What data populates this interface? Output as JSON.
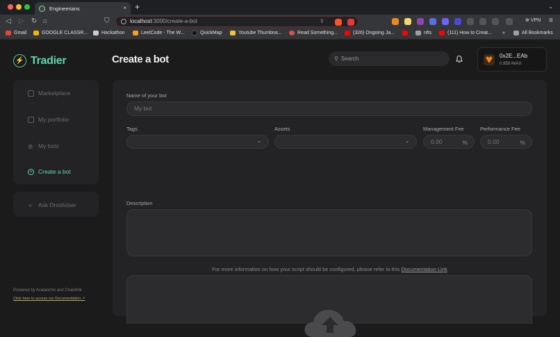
{
  "browser": {
    "tab_title": "Engineerians",
    "tab_close": "×",
    "new_tab": "+",
    "url_host": "localhost",
    "url_path": ":3000/create-a-bot",
    "vpn_label": "VPN",
    "bookmarks": [
      {
        "label": "Gmail",
        "color": "#ea4335"
      },
      {
        "label": "GOOGLE CLASSR...",
        "color": "#f4b400"
      },
      {
        "label": "Hackathon",
        "color": "#cccccc"
      },
      {
        "label": "LeetCode - The W...",
        "color": "#f89f1b"
      },
      {
        "label": "QuickMap",
        "color": "#111111"
      },
      {
        "label": "Youtube Thumbna...",
        "color": "#f4c430"
      },
      {
        "label": "Read Something...",
        "color": "#e34c4c"
      },
      {
        "label": "(326) Ongoing Ja...",
        "color": "#ff0000"
      },
      {
        "label": "",
        "color": "#ff0000"
      },
      {
        "label": "nfts",
        "color": "#9aa0a6"
      },
      {
        "label": "(111) How to Creat...",
        "color": "#ff0000"
      }
    ],
    "more_bookmarks": "»",
    "all_bookmarks": "All Bookmarks"
  },
  "app": {
    "brand": "Tradier",
    "page_title": "Create a bot",
    "search_placeholder": "Search",
    "wallet": {
      "address": "0x2E...EAb",
      "balance": "0.958 AVAX"
    },
    "nav": [
      {
        "label": "Marketplace",
        "icon": "store-icon",
        "active": false
      },
      {
        "label": "My portfolio",
        "icon": "portfolio-icon",
        "active": false
      },
      {
        "label": "My bots",
        "icon": "bot-icon",
        "active": false
      },
      {
        "label": "Create a bot",
        "icon": "plus-circle-icon",
        "active": true
      }
    ],
    "ask_droid": "Ask Droidviser",
    "powered_by": "Powered by Avalanche and Chainlink",
    "docs_link": "Click here to access our Documentation ↗"
  },
  "form": {
    "name_label": "Name of your bot",
    "name_placeholder": "My bot",
    "tags_label": "Tags",
    "assets_label": "Assets",
    "mgmt_fee_label": "Management Fee",
    "mgmt_fee_placeholder": "0.00",
    "perf_fee_label": "Performance Fee",
    "perf_fee_placeholder": "0.00",
    "percent": "%",
    "description_label": "Description",
    "info_text": "For more information on how your script should be configured, please refer to this",
    "info_link": "Documentation Link"
  },
  "colors": {
    "accent": "#5fd9ac",
    "background": "#1b1b1c",
    "panel": "#232325"
  }
}
